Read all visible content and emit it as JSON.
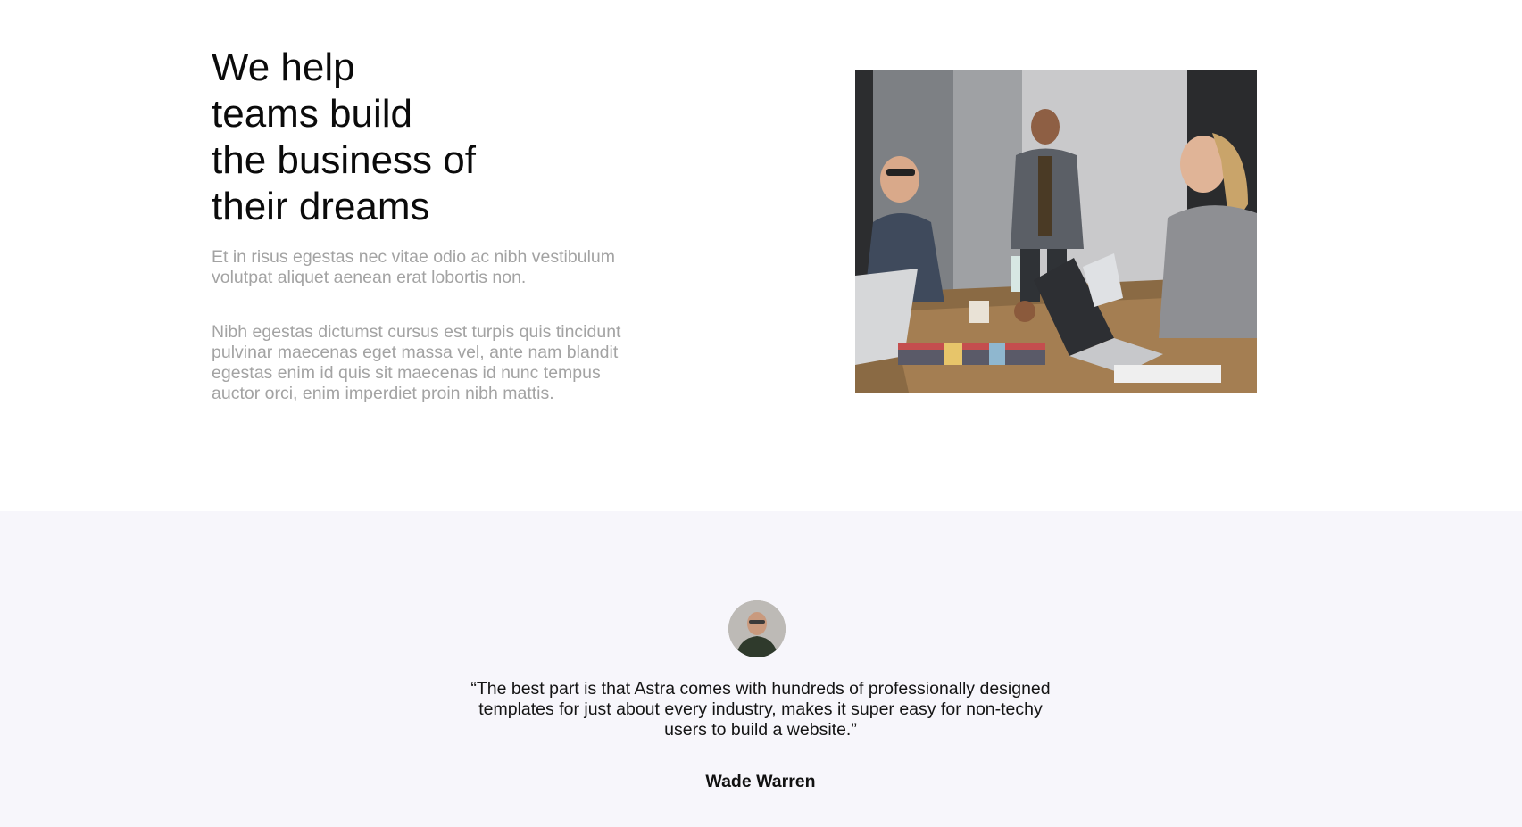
{
  "hero": {
    "title": "We help\nteams build\nthe business of\ntheir dreams",
    "paragraph_1": "Et in risus egestas nec vitae odio ac nibh vestibulum\nvolutpat aliquet aenean erat lobortis non.",
    "paragraph_2": "Nibh egestas dictumst cursus est turpis quis tincidunt\npulvinar maecenas eget massa vel, ante nam blandit\negestas enim id quis sit maecenas id nunc tempus\nauctor orci, enim imperdiet proin nibh mattis.",
    "image": "team-meeting-photo"
  },
  "testimonial": {
    "avatar": "person-avatar",
    "quote": "“The best part is that Astra comes with hundreds of professionally designed\ntemplates for just about every industry, makes it super easy for non-techy\nusers to build a website.”",
    "author": "Wade Warren"
  },
  "colors": {
    "heading": "#0b0b0b",
    "muted_text": "#a3a3a3",
    "testimonial_bg": "#f7f6fb"
  }
}
